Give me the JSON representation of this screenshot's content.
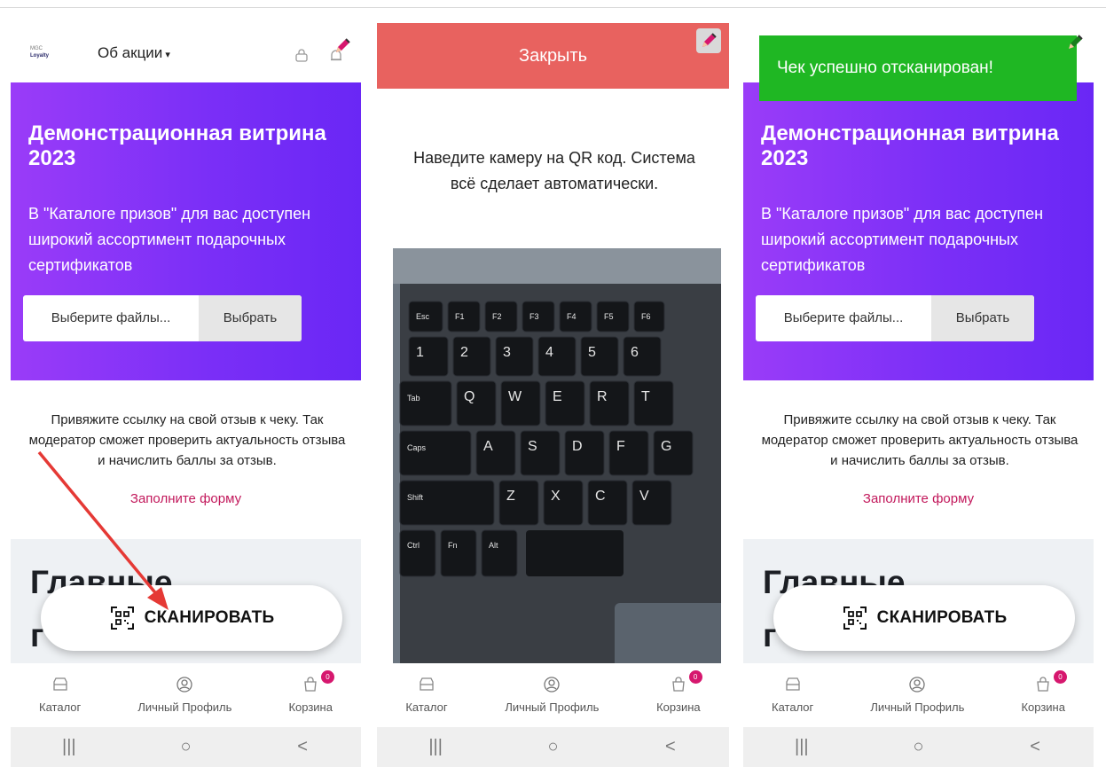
{
  "screens": [
    {
      "header": {
        "logo_line1": "MGC",
        "logo_line2": "Loyalty",
        "about_label": "Об акции",
        "caret": "▾"
      },
      "banner": {
        "title": "Демонстрационная витрина 2023",
        "text": "В \"Каталоге призов\" для вас доступен широкий ассортимент подарочных сертификатов",
        "file_placeholder": "Выберите файлы...",
        "file_button": "Выбрать"
      },
      "review_text": "Привяжите ссылку на свой отзыв к чеку. Так модератор сможет проверить актуальность отзыва и начислить баллы за отзыв.",
      "form_link": "Заполните форму",
      "main_title_part1": "Главные",
      "main_title_part2": "г",
      "scan_label": "СКАНИРОВАТЬ"
    },
    {
      "close_label": "Закрыть",
      "instruction": "Наведите камеру на QR код. Система всё сделает автоматически."
    },
    {
      "toast": "Чек успешно отсканирован!"
    }
  ],
  "nav": {
    "catalog": "Каталог",
    "profile": "Личный Профиль",
    "cart": "Корзина",
    "cart_badge": "0"
  },
  "system_bar": {
    "recents": "|||",
    "home": "○",
    "back": "<"
  },
  "keyboard": {
    "row1": [
      "Esc",
      "F1",
      "F2",
      "F3",
      "F4",
      "F5",
      "F6"
    ],
    "row2": [
      "1",
      "2",
      "3",
      "4",
      "5",
      "6"
    ],
    "row3": [
      "Tab",
      "Q",
      "W",
      "E",
      "R",
      "T"
    ],
    "row4": [
      "Caps",
      "A",
      "S",
      "D",
      "F",
      "G"
    ],
    "row5": [
      "Shift",
      "Z",
      "X",
      "C",
      "V"
    ],
    "row6": [
      "Ctrl",
      "Fn",
      "Alt"
    ]
  },
  "colors": {
    "banner": "#7b2ff7",
    "close": "#e8625f",
    "toast": "#1fb723",
    "accent": "#c2185b",
    "arrow": "#e53935"
  },
  "icons": [
    "lock-icon",
    "bell-icon",
    "pencil-icon",
    "qr-scan-icon",
    "catalog-icon",
    "profile-icon",
    "cart-icon"
  ]
}
